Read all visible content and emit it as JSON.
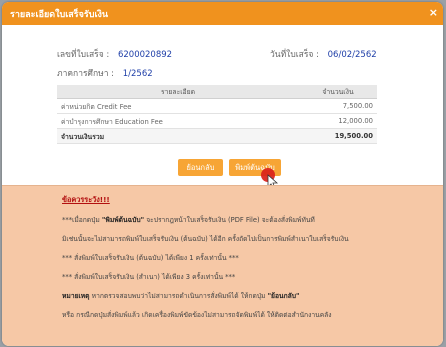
{
  "dialog": {
    "title": "รายละเอียดใบเสร็จรับเงิน",
    "close_glyph": "×"
  },
  "receipt": {
    "number_label": "เลขที่ใบเสร็จ :",
    "number_value": "6200020892",
    "date_label": "วันที่ใบเสร็จ :",
    "date_value": "06/02/2562",
    "term_label": "ภาคการศึกษา :",
    "term_value": "1/2562"
  },
  "table": {
    "headers": [
      "รายละเอียด",
      "จำนวนเงิน"
    ],
    "rows": [
      {
        "desc": "ค่าหน่วยกิต Credit Fee",
        "amount": "7,500.00"
      },
      {
        "desc": "ค่าบำรุงการศึกษา Education Fee",
        "amount": "12,000.00"
      }
    ],
    "total": {
      "desc": "จำนวนเงินรวม",
      "amount": "19,500.00"
    }
  },
  "buttons": {
    "back": "ย้อนกลับ",
    "print_original": "พิมพ์ต้นฉบับ"
  },
  "warning": {
    "title": "ข้อควรระวัง!!!",
    "l1_pre": "***เมื่อกดปุ่ม ",
    "l1_bold": "\"พิมพ์ต้นฉบับ\"",
    "l1_post": " จะปรากฎหน้าใบเสร็จรับเงิน (PDF File) จะต้องสั่งพิมพ์ทันที",
    "l2": "มิเช่นนั้นจะไม่สามารถพิมพ์ใบเสร็จรับเงิน (ต้นฉบับ) ได้อีก ครั้งถัดไปเป็นการพิมพ์สำเนาใบเสร็จรับเงิน",
    "l3": "*** สั่งพิมพ์ใบเสร็จรับเงิน (ต้นฉบับ) ได้เพียง 1 ครั้งเท่านั้น ***",
    "l4": "*** สั่งพิมพ์ใบเสร็จรับเงิน (สำเนา) ได้เพียง 3 ครั้งเท่านั้น ***",
    "l5_bold": "หมายเหตุ",
    "l5_mid": " หากตรวจสอบพบว่าไม่สามารถดำเนินการสั่งพิมพ์ได้ ให้กดปุ่ม ",
    "l5_bold2": "\"ย้อนกลับ\"",
    "l6": "หรือ กรณีกดปุ่มสั่งพิมพ์แล้ว เกิดเครื่องพิมพ์ขัดข้องไม่สามารถจัดพิมพ์ได้ ให้ติดต่อสำนักงานคลัง"
  },
  "colors": {
    "accent": "#f0921e",
    "button": "#f7a535",
    "warning_bg": "#f6c8a6",
    "warning_title": "#b31010",
    "value_text": "#1f3fa8"
  }
}
